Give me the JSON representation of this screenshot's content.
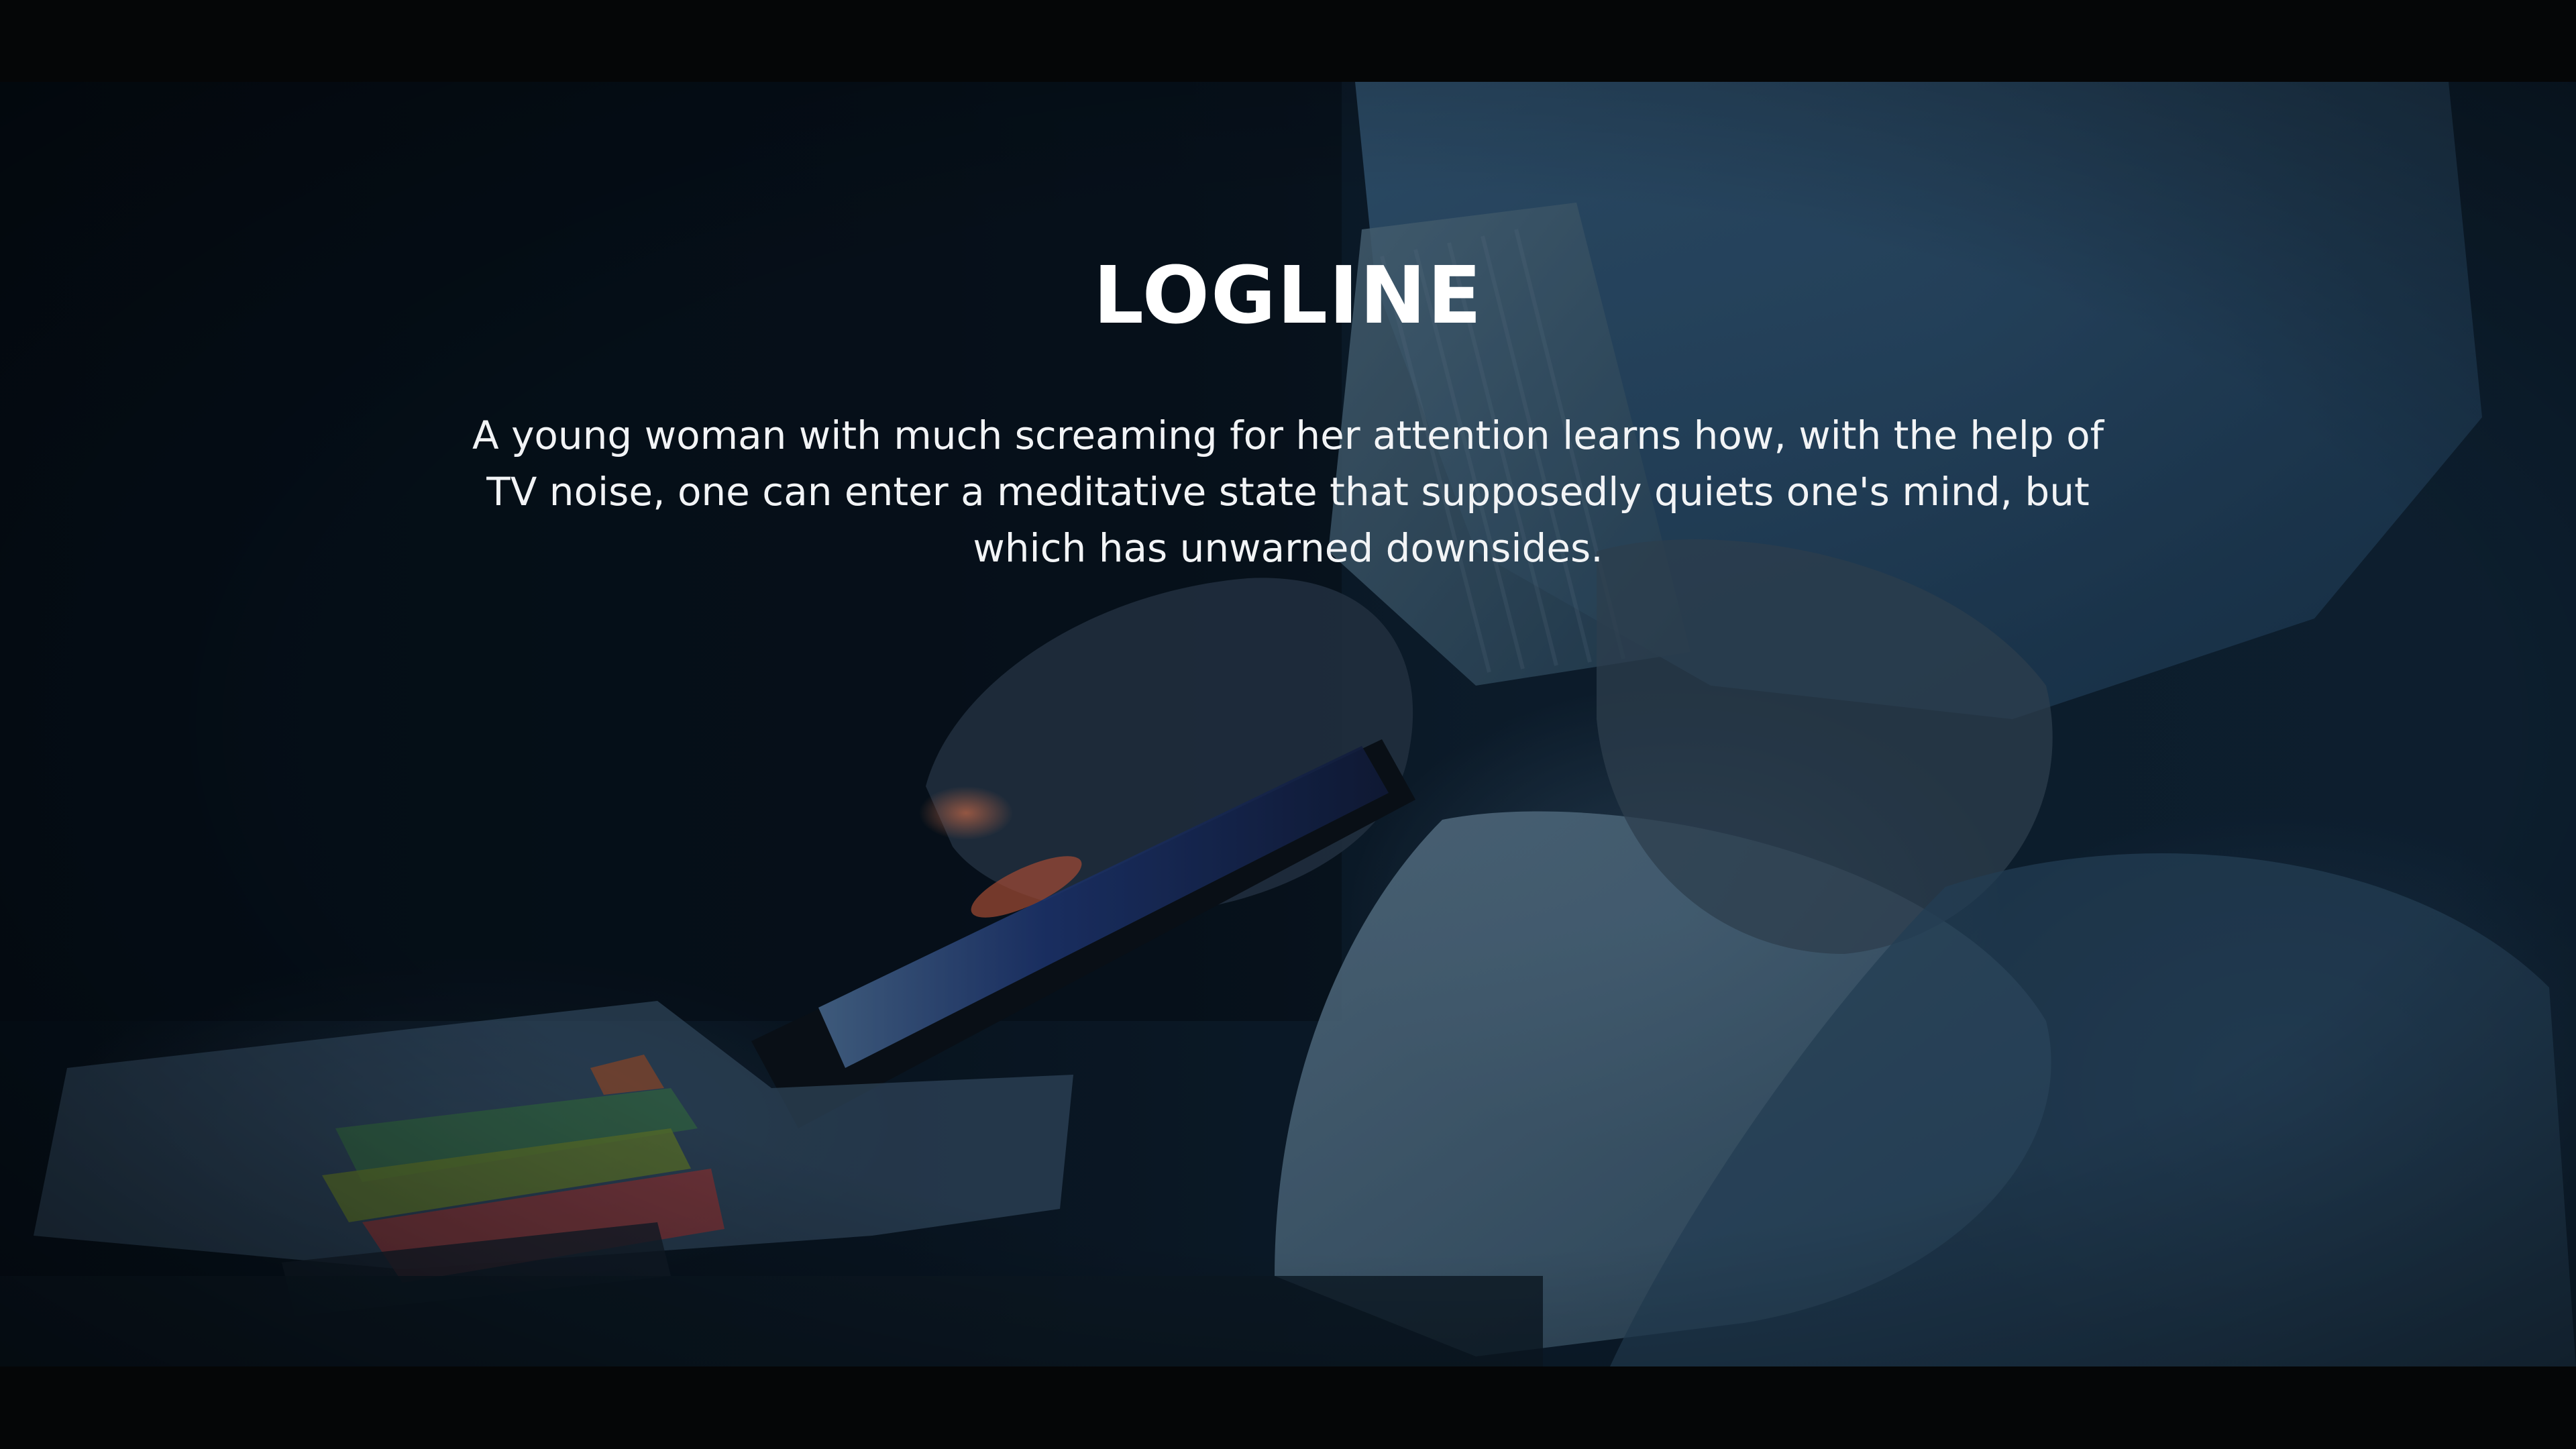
{
  "slide": {
    "title": "LOGLINE",
    "body": "A young woman with much screaming for her attention learns how, with the help of TV noise, one can enter a meditative state that supposedly quiets one's mind, but which has unwarned downsides."
  },
  "colors": {
    "letterbox": "#050607",
    "text": "#ffffff",
    "scene_tint": "#0f2132"
  }
}
